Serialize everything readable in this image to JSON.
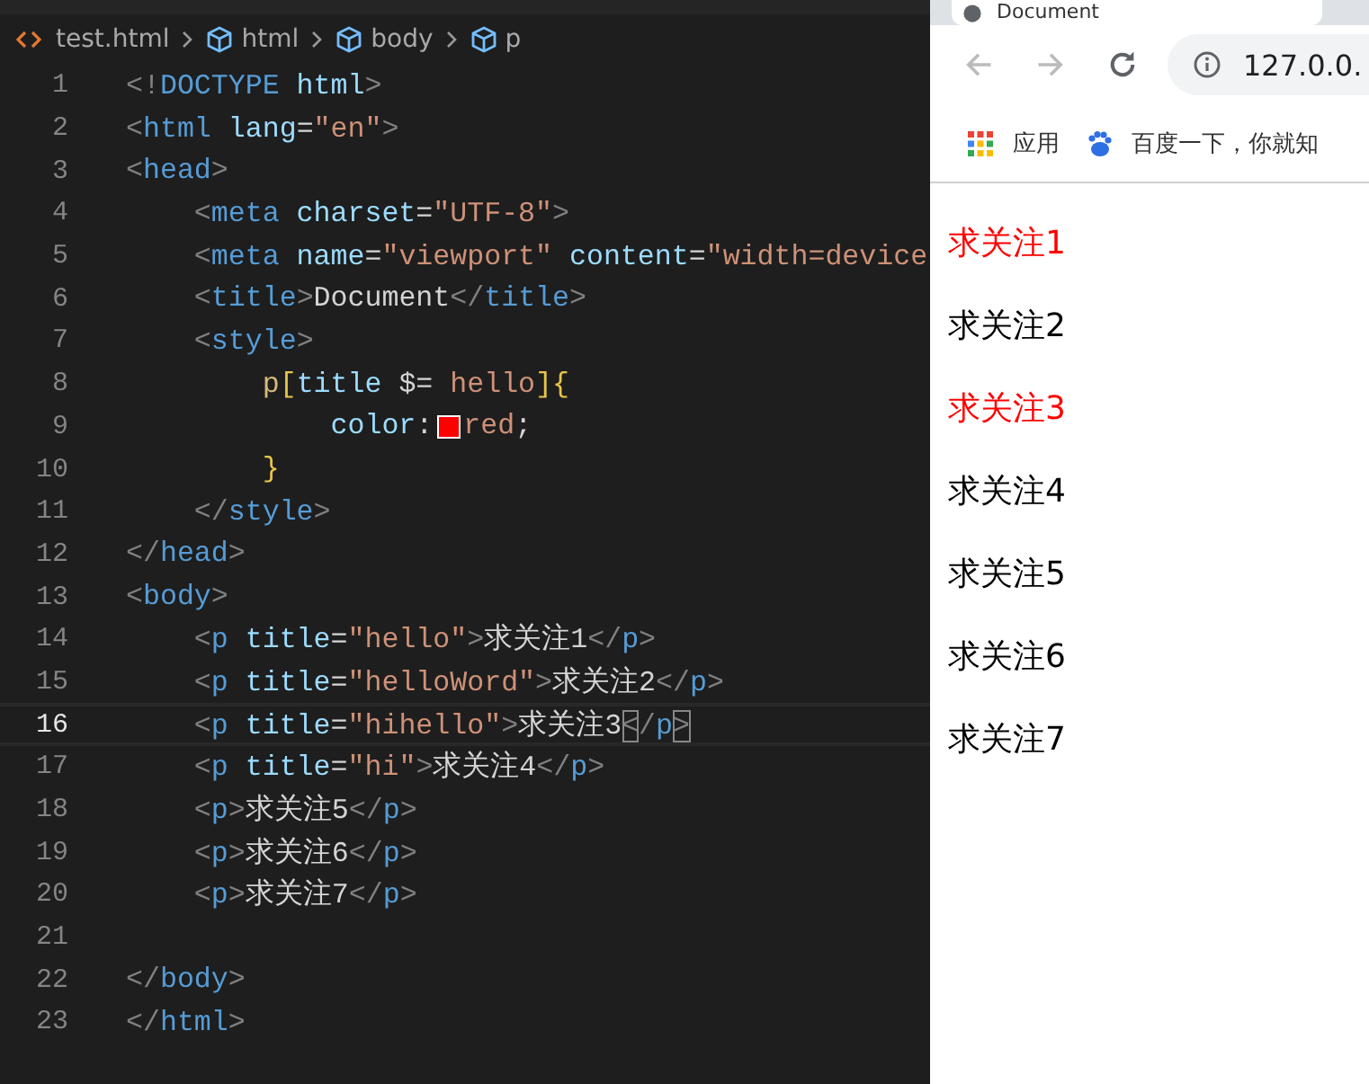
{
  "editor": {
    "breadcrumb": [
      {
        "kind": "file",
        "label": "test.html"
      },
      {
        "kind": "element",
        "label": "html"
      },
      {
        "kind": "element",
        "label": "body"
      },
      {
        "kind": "element",
        "label": "p"
      }
    ],
    "lines": [
      {
        "number": "1",
        "current": false,
        "tokens": [
          {
            "kind": "punct",
            "text": "<!"
          },
          {
            "kind": "tag",
            "text": "DOCTYPE"
          },
          {
            "kind": "attr",
            "text": " html"
          },
          {
            "kind": "punct",
            "text": ">"
          }
        ]
      },
      {
        "number": "2",
        "current": false,
        "tokens": [
          {
            "kind": "punct",
            "text": "<"
          },
          {
            "kind": "tag",
            "text": "html"
          },
          {
            "kind": "attr",
            "text": " lang"
          },
          {
            "kind": "text",
            "text": "="
          },
          {
            "kind": "string",
            "text": "\"en\""
          },
          {
            "kind": "punct",
            "text": ">"
          }
        ]
      },
      {
        "number": "3",
        "current": false,
        "tokens": [
          {
            "kind": "punct",
            "text": "<"
          },
          {
            "kind": "tag",
            "text": "head"
          },
          {
            "kind": "punct",
            "text": ">"
          }
        ]
      },
      {
        "number": "4",
        "current": false,
        "tokens": [
          {
            "kind": "punct",
            "text": "    <"
          },
          {
            "kind": "tag",
            "text": "meta"
          },
          {
            "kind": "attr",
            "text": " charset"
          },
          {
            "kind": "text",
            "text": "="
          },
          {
            "kind": "string",
            "text": "\"UTF-8\""
          },
          {
            "kind": "punct",
            "text": ">"
          }
        ]
      },
      {
        "number": "5",
        "current": false,
        "tokens": [
          {
            "kind": "punct",
            "text": "    <"
          },
          {
            "kind": "tag",
            "text": "meta"
          },
          {
            "kind": "attr",
            "text": " name"
          },
          {
            "kind": "text",
            "text": "="
          },
          {
            "kind": "string",
            "text": "\"viewport\""
          },
          {
            "kind": "attr",
            "text": " content"
          },
          {
            "kind": "text",
            "text": "="
          },
          {
            "kind": "string",
            "text": "\"width=device"
          }
        ]
      },
      {
        "number": "6",
        "current": false,
        "tokens": [
          {
            "kind": "punct",
            "text": "    <"
          },
          {
            "kind": "tag",
            "text": "title"
          },
          {
            "kind": "punct",
            "text": ">"
          },
          {
            "kind": "text",
            "text": "Document"
          },
          {
            "kind": "punct",
            "text": "</"
          },
          {
            "kind": "tag",
            "text": "title"
          },
          {
            "kind": "punct",
            "text": ">"
          }
        ]
      },
      {
        "number": "7",
        "current": false,
        "tokens": [
          {
            "kind": "punct",
            "text": "    <"
          },
          {
            "kind": "tag",
            "text": "style"
          },
          {
            "kind": "punct",
            "text": ">"
          }
        ]
      },
      {
        "number": "8",
        "current": false,
        "tokens": [
          {
            "kind": "selector",
            "text": "        p"
          },
          {
            "kind": "brace",
            "text": "["
          },
          {
            "kind": "attr",
            "text": "title"
          },
          {
            "kind": "text",
            "text": " $= "
          },
          {
            "kind": "string",
            "text": "hello"
          },
          {
            "kind": "brace",
            "text": "]{"
          }
        ]
      },
      {
        "number": "9",
        "current": false,
        "tokens": [
          {
            "kind": "attr",
            "text": "            color"
          },
          {
            "kind": "text",
            "text": ":"
          },
          {
            "kind": "swatch",
            "color": "#ff0000"
          },
          {
            "kind": "string",
            "text": "red"
          },
          {
            "kind": "text",
            "text": ";"
          }
        ]
      },
      {
        "number": "10",
        "current": false,
        "tokens": [
          {
            "kind": "brace",
            "text": "        }"
          }
        ]
      },
      {
        "number": "11",
        "current": false,
        "tokens": [
          {
            "kind": "punct",
            "text": "    </"
          },
          {
            "kind": "tag",
            "text": "style"
          },
          {
            "kind": "punct",
            "text": ">"
          }
        ]
      },
      {
        "number": "12",
        "current": false,
        "tokens": [
          {
            "kind": "punct",
            "text": "</"
          },
          {
            "kind": "tag",
            "text": "head"
          },
          {
            "kind": "punct",
            "text": ">"
          }
        ]
      },
      {
        "number": "13",
        "current": false,
        "tokens": [
          {
            "kind": "punct",
            "text": "<"
          },
          {
            "kind": "tag",
            "text": "body"
          },
          {
            "kind": "punct",
            "text": ">"
          }
        ]
      },
      {
        "number": "14",
        "current": false,
        "tokens": [
          {
            "kind": "punct",
            "text": "    <"
          },
          {
            "kind": "tag",
            "text": "p"
          },
          {
            "kind": "attr",
            "text": " title"
          },
          {
            "kind": "text",
            "text": "="
          },
          {
            "kind": "string",
            "text": "\"hello\""
          },
          {
            "kind": "punct",
            "text": ">"
          },
          {
            "kind": "text",
            "text": "求关注1"
          },
          {
            "kind": "punct",
            "text": "</"
          },
          {
            "kind": "tag",
            "text": "p"
          },
          {
            "kind": "punct",
            "text": ">"
          }
        ]
      },
      {
        "number": "15",
        "current": false,
        "tokens": [
          {
            "kind": "punct",
            "text": "    <"
          },
          {
            "kind": "tag",
            "text": "p"
          },
          {
            "kind": "attr",
            "text": " title"
          },
          {
            "kind": "text",
            "text": "="
          },
          {
            "kind": "string",
            "text": "\"helloWord\""
          },
          {
            "kind": "punct",
            "text": ">"
          },
          {
            "kind": "text",
            "text": "求关注2"
          },
          {
            "kind": "punct",
            "text": "</"
          },
          {
            "kind": "tag",
            "text": "p"
          },
          {
            "kind": "punct",
            "text": ">"
          }
        ]
      },
      {
        "number": "16",
        "current": true,
        "tokens": [
          {
            "kind": "punct",
            "text": "    <"
          },
          {
            "kind": "tag",
            "text": "p"
          },
          {
            "kind": "attr",
            "text": " title"
          },
          {
            "kind": "text",
            "text": "="
          },
          {
            "kind": "string",
            "text": "\"hihello\""
          },
          {
            "kind": "punct",
            "text": ">"
          },
          {
            "kind": "text",
            "text": "求关注3"
          },
          {
            "kind": "match",
            "text": "<"
          },
          {
            "kind": "punct",
            "text": "/"
          },
          {
            "kind": "tag",
            "text": "p"
          },
          {
            "kind": "match",
            "text": ">"
          }
        ]
      },
      {
        "number": "17",
        "current": false,
        "tokens": [
          {
            "kind": "punct",
            "text": "    <"
          },
          {
            "kind": "tag",
            "text": "p"
          },
          {
            "kind": "attr",
            "text": " title"
          },
          {
            "kind": "text",
            "text": "="
          },
          {
            "kind": "string",
            "text": "\"hi\""
          },
          {
            "kind": "punct",
            "text": ">"
          },
          {
            "kind": "text",
            "text": "求关注4"
          },
          {
            "kind": "punct",
            "text": "</"
          },
          {
            "kind": "tag",
            "text": "p"
          },
          {
            "kind": "punct",
            "text": ">"
          }
        ]
      },
      {
        "number": "18",
        "current": false,
        "tokens": [
          {
            "kind": "punct",
            "text": "    <"
          },
          {
            "kind": "tag",
            "text": "p"
          },
          {
            "kind": "punct",
            "text": ">"
          },
          {
            "kind": "text",
            "text": "求关注5"
          },
          {
            "kind": "punct",
            "text": "</"
          },
          {
            "kind": "tag",
            "text": "p"
          },
          {
            "kind": "punct",
            "text": ">"
          }
        ]
      },
      {
        "number": "19",
        "current": false,
        "tokens": [
          {
            "kind": "punct",
            "text": "    <"
          },
          {
            "kind": "tag",
            "text": "p"
          },
          {
            "kind": "punct",
            "text": ">"
          },
          {
            "kind": "text",
            "text": "求关注6"
          },
          {
            "kind": "punct",
            "text": "</"
          },
          {
            "kind": "tag",
            "text": "p"
          },
          {
            "kind": "punct",
            "text": ">"
          }
        ]
      },
      {
        "number": "20",
        "current": false,
        "tokens": [
          {
            "kind": "punct",
            "text": "    <"
          },
          {
            "kind": "tag",
            "text": "p"
          },
          {
            "kind": "punct",
            "text": ">"
          },
          {
            "kind": "text",
            "text": "求关注7"
          },
          {
            "kind": "punct",
            "text": "</"
          },
          {
            "kind": "tag",
            "text": "p"
          },
          {
            "kind": "punct",
            "text": ">"
          }
        ]
      },
      {
        "number": "21",
        "current": false
      },
      {
        "number": "22",
        "current": false,
        "tokens": [
          {
            "kind": "punct",
            "text": "</"
          },
          {
            "kind": "tag",
            "text": "body"
          },
          {
            "kind": "punct",
            "text": ">"
          }
        ]
      },
      {
        "number": "23",
        "current": false,
        "tokens": [
          {
            "kind": "punct",
            "text": "</"
          },
          {
            "kind": "tag",
            "text": "html"
          },
          {
            "kind": "punct",
            "text": ">"
          }
        ]
      }
    ]
  },
  "browser": {
    "tab_title": "Document",
    "address": "127.0.0.",
    "bookmarks": [
      {
        "kind": "apps",
        "label": "应用"
      },
      {
        "kind": "site",
        "label": "百度一下，你就知"
      }
    ],
    "paragraphs": [
      {
        "text": "求关注1",
        "color": "#ff0000"
      },
      {
        "text": "求关注2",
        "color": "#000000"
      },
      {
        "text": "求关注3",
        "color": "#ff0000"
      },
      {
        "text": "求关注4",
        "color": "#000000"
      },
      {
        "text": "求关注5",
        "color": "#000000"
      },
      {
        "text": "求关注6",
        "color": "#000000"
      },
      {
        "text": "求关注7",
        "color": "#000000"
      }
    ]
  }
}
